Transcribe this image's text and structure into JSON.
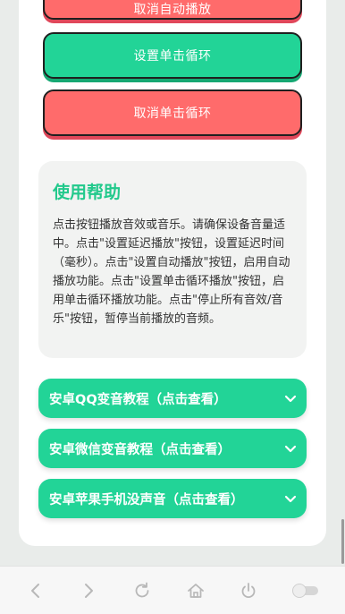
{
  "buttons": {
    "top_label": "取消自动播放",
    "set_single_loop": "设置单击循环",
    "cancel_single_loop": "取消单击循环"
  },
  "help": {
    "title": "使用帮助",
    "body": "点击按钮播放音效或音乐。请确保设备音量适中。点击\"设置延迟播放\"按钮，设置延迟时间（毫秒）。点击\"设置自动播放\"按钮，启用自动播放功能。点击\"设置单击循环播放\"按钮，启用单击循环播放功能。点击\"停止所有音效/音乐\"按钮，暂停当前播放的音频。"
  },
  "accordions": [
    {
      "label": "安卓QQ变音教程（点击查看）"
    },
    {
      "label": "安卓微信变音教程（点击查看）"
    },
    {
      "label": "安卓苹果手机没声音（点击查看）"
    }
  ],
  "navbar": {
    "icons": [
      "back-icon",
      "forward-icon",
      "refresh-icon",
      "home-icon",
      "power-icon",
      "toggle-icon"
    ]
  },
  "colors": {
    "accent_green": "#22d497",
    "accent_red": "#ff6b6b",
    "help_title": "#22c98c"
  }
}
